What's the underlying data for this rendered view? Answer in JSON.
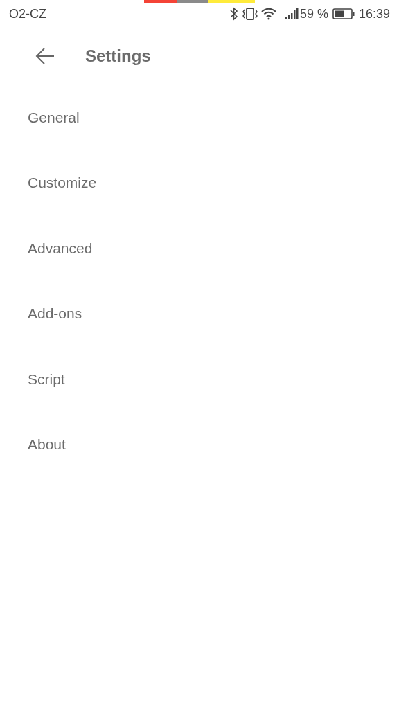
{
  "status_bar": {
    "carrier": "O2-CZ",
    "battery_percent": "59 %",
    "time": "16:39"
  },
  "header": {
    "title": "Settings"
  },
  "menu": [
    {
      "label": "General"
    },
    {
      "label": "Customize"
    },
    {
      "label": "Advanced"
    },
    {
      "label": "Add-ons"
    },
    {
      "label": "Script"
    },
    {
      "label": "About"
    }
  ]
}
